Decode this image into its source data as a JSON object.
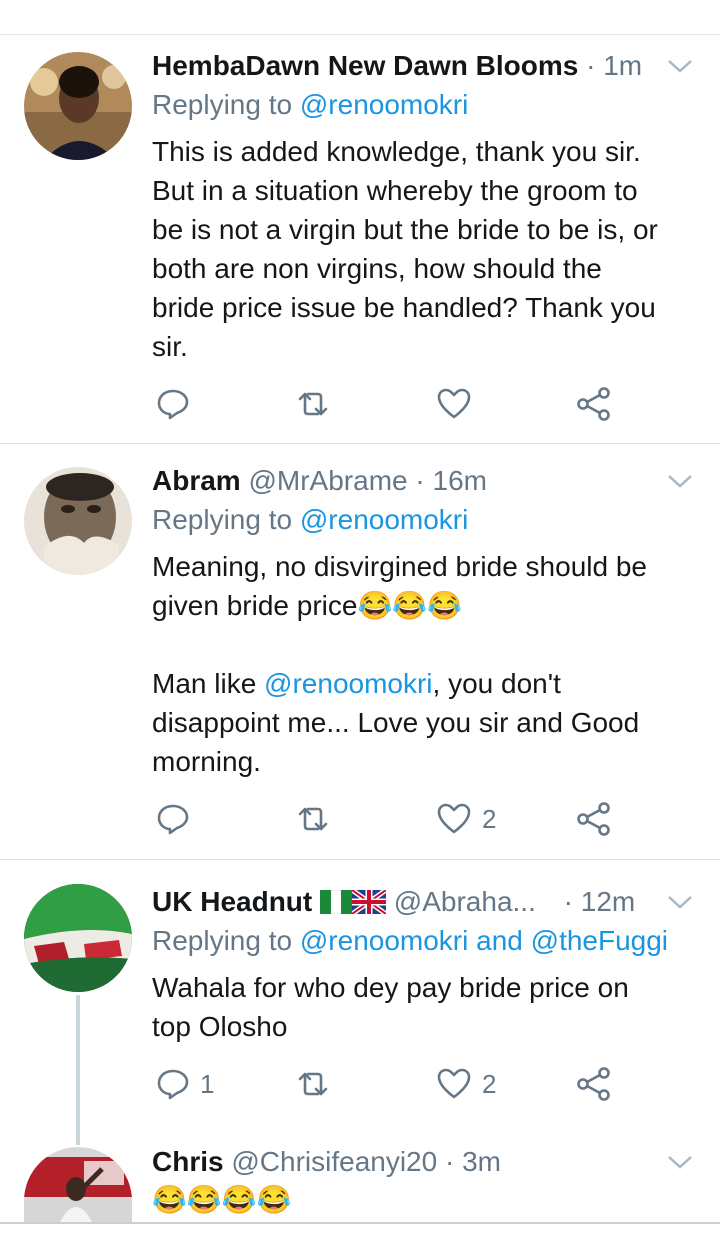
{
  "tweets": [
    {
      "name": "HembaDawn New Dawn Blooms",
      "handle": "",
      "dot": "·",
      "time": "1m",
      "reply_prefix": "Replying to ",
      "reply_to": "@renoomokri",
      "reply_joiner": "",
      "reply_to_2": "",
      "body_lines": [
        "This is added knowledge, thank you sir.",
        "But in a situation whereby the groom to",
        "be is not a virgin but the bride to be is, or",
        "both are non virgins, how should the",
        "bride price issue be handled? Thank you",
        "sir."
      ],
      "replies": "",
      "likes": ""
    },
    {
      "name": "Abram",
      "handle": "@MrAbrame",
      "dot": "·",
      "time": "16m",
      "reply_prefix": "Replying to ",
      "reply_to": "@renoomokri",
      "body_line1": "Meaning, no disvirgined bride should be",
      "body_line2": "given bride price",
      "emoji": "😂😂😂",
      "body_line3_prefix": "Man like ",
      "body_line3_mention": "@renoomokri",
      "body_line3_suffix": ", you don't",
      "body_line4": "disappoint me... Love you sir and Good",
      "body_line5": "morning.",
      "replies": "",
      "likes": "2"
    },
    {
      "name": "UK Headnut",
      "handle": "@Abraha...",
      "dot": "·",
      "time": "12m",
      "reply_prefix": "Replying to ",
      "reply_to": "@renoomokri",
      "reply_joiner": " and ",
      "reply_to_2": "@theFuggi",
      "body_lines": [
        "Wahala for who dey pay bride price on",
        "top Olosho"
      ],
      "replies": "1",
      "likes": "2"
    },
    {
      "name": "Chris",
      "handle": "@Chrisifeanyi20",
      "dot": "·",
      "time": "3m",
      "emoji": "😂😂😂😂"
    }
  ],
  "colors": {
    "link": "#1b95e0",
    "secondary": "#657786",
    "text": "#14171a",
    "divider": "#dfe3e6"
  },
  "icons": [
    "reply-icon",
    "retweet-icon",
    "like-icon",
    "share-icon",
    "chevron-down-icon",
    "nigeria-flag-icon",
    "uk-flag-icon"
  ]
}
